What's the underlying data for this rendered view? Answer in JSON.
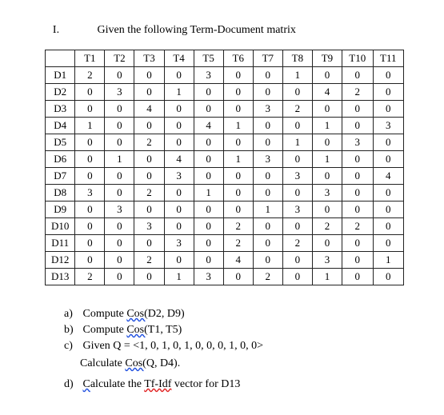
{
  "header": {
    "roman": "I.",
    "title": "Given the following Term-Document matrix"
  },
  "table": {
    "col_headers": [
      "T1",
      "T2",
      "T3",
      "T4",
      "T5",
      "T6",
      "T7",
      "T8",
      "T9",
      "T10",
      "T11"
    ],
    "rows": [
      {
        "label": "D1",
        "cells": [
          "2",
          "0",
          "0",
          "0",
          "3",
          "0",
          "0",
          "1",
          "0",
          "0",
          "0"
        ]
      },
      {
        "label": "D2",
        "cells": [
          "0",
          "3",
          "0",
          "1",
          "0",
          "0",
          "0",
          "0",
          "4",
          "2",
          "0"
        ]
      },
      {
        "label": "D3",
        "cells": [
          "0",
          "0",
          "4",
          "0",
          "0",
          "0",
          "3",
          "2",
          "0",
          "0",
          "0"
        ]
      },
      {
        "label": "D4",
        "cells": [
          "1",
          "0",
          "0",
          "0",
          "4",
          "1",
          "0",
          "0",
          "1",
          "0",
          "3"
        ]
      },
      {
        "label": "D5",
        "cells": [
          "0",
          "0",
          "2",
          "0",
          "0",
          "0",
          "0",
          "1",
          "0",
          "3",
          "0"
        ]
      },
      {
        "label": "D6",
        "cells": [
          "0",
          "1",
          "0",
          "4",
          "0",
          "1",
          "3",
          "0",
          "1",
          "0",
          "0"
        ]
      },
      {
        "label": "D7",
        "cells": [
          "0",
          "0",
          "0",
          "3",
          "0",
          "0",
          "0",
          "3",
          "0",
          "0",
          "4"
        ]
      },
      {
        "label": "D8",
        "cells": [
          "3",
          "0",
          "2",
          "0",
          "1",
          "0",
          "0",
          "0",
          "3",
          "0",
          "0"
        ]
      },
      {
        "label": "D9",
        "cells": [
          "0",
          "3",
          "0",
          "0",
          "0",
          "0",
          "1",
          "3",
          "0",
          "0",
          "0"
        ]
      },
      {
        "label": "D10",
        "cells": [
          "0",
          "0",
          "3",
          "0",
          "0",
          "2",
          "0",
          "0",
          "2",
          "2",
          "0"
        ]
      },
      {
        "label": "D11",
        "cells": [
          "0",
          "0",
          "0",
          "3",
          "0",
          "2",
          "0",
          "2",
          "0",
          "0",
          "0"
        ]
      },
      {
        "label": "D12",
        "cells": [
          "0",
          "0",
          "2",
          "0",
          "0",
          "4",
          "0",
          "0",
          "3",
          "0",
          "1"
        ]
      },
      {
        "label": "D13",
        "cells": [
          "2",
          "0",
          "0",
          "1",
          "3",
          "0",
          "2",
          "0",
          "1",
          "0",
          "0"
        ]
      }
    ]
  },
  "questions": {
    "a": {
      "letter": "a)",
      "pre": "Compute ",
      "fn": "Cos(",
      "args": "D2, D9)"
    },
    "b": {
      "letter": "b)",
      "pre": "Compute ",
      "fn": "Cos(",
      "args": "T1, T5)"
    },
    "c": {
      "letter": "c)",
      "text": "Given Q = <1, 0, 1, 0, 1, 0, 0, 0, 1, 0, 0>"
    },
    "c2": {
      "pre": "Calculate ",
      "fn": "Cos(",
      "args": "Q, D4)."
    },
    "d": {
      "letter": "d)",
      "pre_c": "C",
      "pre_rest": "alculate the ",
      "fn": "Tf-Idf",
      "post": " vector for D13"
    }
  }
}
